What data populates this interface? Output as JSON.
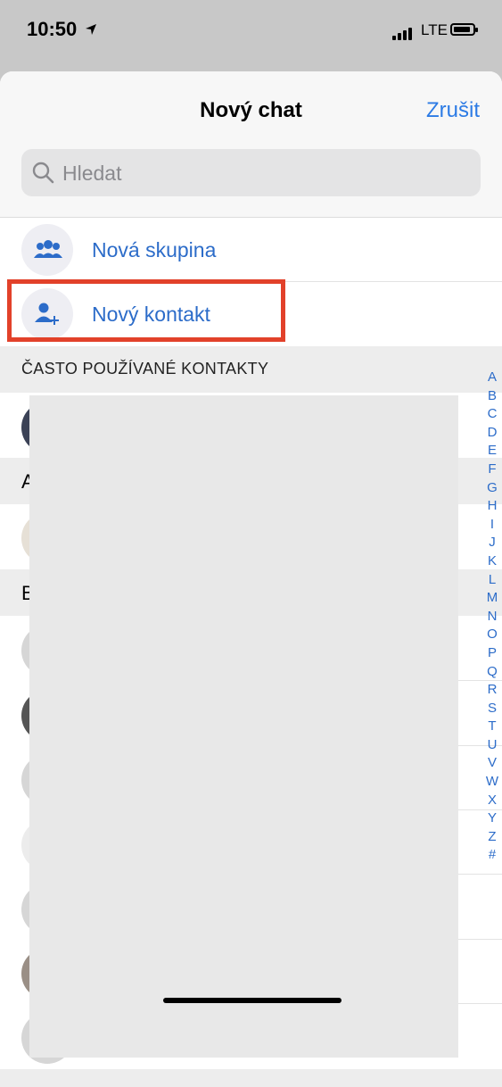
{
  "status_bar": {
    "time": "10:50",
    "network": "LTE"
  },
  "header": {
    "title": "Nový chat",
    "cancel_label": "Zrušit"
  },
  "search": {
    "placeholder": "Hledat"
  },
  "actions": {
    "new_group": "Nová skupina",
    "new_contact": "Nový kontakt"
  },
  "sections": {
    "frequent": "ČASTO POUŽÍVANÉ KONTAKTY",
    "a": "A",
    "b": "B"
  },
  "index": [
    "A",
    "B",
    "C",
    "D",
    "E",
    "F",
    "G",
    "H",
    "I",
    "J",
    "K",
    "L",
    "M",
    "N",
    "O",
    "P",
    "Q",
    "R",
    "S",
    "T",
    "U",
    "V",
    "W",
    "X",
    "Y",
    "Z",
    "#"
  ],
  "colors": {
    "accent": "#2c6cc9",
    "highlight": "#e2412a"
  }
}
